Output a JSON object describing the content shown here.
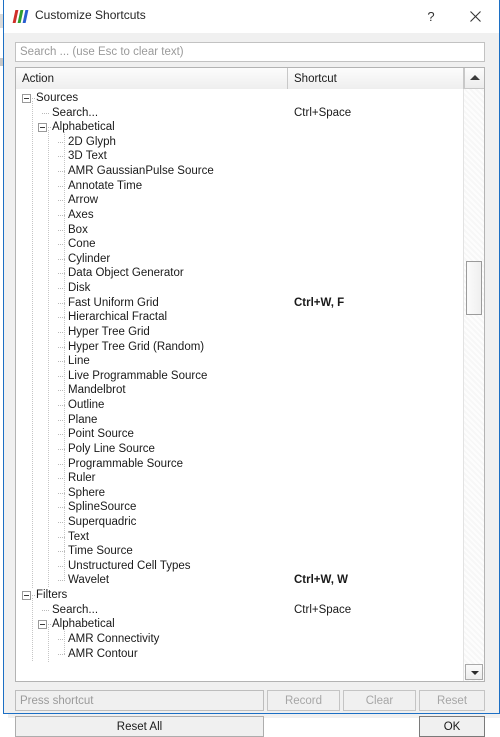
{
  "window": {
    "title": "Customize Shortcuts",
    "icon": "paraview-logo-icon",
    "help_label": "?",
    "close_label": "✕"
  },
  "search": {
    "placeholder": "Search ... (use Esc to clear text)",
    "value": ""
  },
  "table": {
    "columns": [
      "Action",
      "Shortcut"
    ],
    "sort_indicator": "up-arrow-icon"
  },
  "tree": [
    {
      "label": "Sources",
      "shortcut": "",
      "depth": 0,
      "expander": true,
      "group": true
    },
    {
      "label": "Search...",
      "shortcut": "Ctrl+Space",
      "depth": 1,
      "expander": false,
      "group": false
    },
    {
      "label": "Alphabetical",
      "shortcut": "",
      "depth": 1,
      "expander": true,
      "group": false
    },
    {
      "label": "2D Glyph",
      "shortcut": "",
      "depth": 2,
      "expander": false,
      "group": false
    },
    {
      "label": "3D Text",
      "shortcut": "",
      "depth": 2,
      "expander": false,
      "group": false
    },
    {
      "label": "AMR GaussianPulse Source",
      "shortcut": "",
      "depth": 2,
      "expander": false,
      "group": false
    },
    {
      "label": "Annotate Time",
      "shortcut": "",
      "depth": 2,
      "expander": false,
      "group": false
    },
    {
      "label": "Arrow",
      "shortcut": "",
      "depth": 2,
      "expander": false,
      "group": false
    },
    {
      "label": "Axes",
      "shortcut": "",
      "depth": 2,
      "expander": false,
      "group": false
    },
    {
      "label": "Box",
      "shortcut": "",
      "depth": 2,
      "expander": false,
      "group": false
    },
    {
      "label": "Cone",
      "shortcut": "",
      "depth": 2,
      "expander": false,
      "group": false
    },
    {
      "label": "Cylinder",
      "shortcut": "",
      "depth": 2,
      "expander": false,
      "group": false
    },
    {
      "label": "Data Object Generator",
      "shortcut": "",
      "depth": 2,
      "expander": false,
      "group": false
    },
    {
      "label": "Disk",
      "shortcut": "",
      "depth": 2,
      "expander": false,
      "group": false
    },
    {
      "label": "Fast Uniform Grid",
      "shortcut": "Ctrl+W, F",
      "depth": 2,
      "expander": false,
      "group": false,
      "bold": true
    },
    {
      "label": "Hierarchical Fractal",
      "shortcut": "",
      "depth": 2,
      "expander": false,
      "group": false
    },
    {
      "label": "Hyper Tree Grid",
      "shortcut": "",
      "depth": 2,
      "expander": false,
      "group": false
    },
    {
      "label": "Hyper Tree Grid (Random)",
      "shortcut": "",
      "depth": 2,
      "expander": false,
      "group": false
    },
    {
      "label": "Line",
      "shortcut": "",
      "depth": 2,
      "expander": false,
      "group": false
    },
    {
      "label": "Live Programmable Source",
      "shortcut": "",
      "depth": 2,
      "expander": false,
      "group": false
    },
    {
      "label": "Mandelbrot",
      "shortcut": "",
      "depth": 2,
      "expander": false,
      "group": false
    },
    {
      "label": "Outline",
      "shortcut": "",
      "depth": 2,
      "expander": false,
      "group": false
    },
    {
      "label": "Plane",
      "shortcut": "",
      "depth": 2,
      "expander": false,
      "group": false
    },
    {
      "label": "Point Source",
      "shortcut": "",
      "depth": 2,
      "expander": false,
      "group": false
    },
    {
      "label": "Poly Line Source",
      "shortcut": "",
      "depth": 2,
      "expander": false,
      "group": false
    },
    {
      "label": "Programmable Source",
      "shortcut": "",
      "depth": 2,
      "expander": false,
      "group": false
    },
    {
      "label": "Ruler",
      "shortcut": "",
      "depth": 2,
      "expander": false,
      "group": false
    },
    {
      "label": "Sphere",
      "shortcut": "",
      "depth": 2,
      "expander": false,
      "group": false
    },
    {
      "label": "SplineSource",
      "shortcut": "",
      "depth": 2,
      "expander": false,
      "group": false
    },
    {
      "label": "Superquadric",
      "shortcut": "",
      "depth": 2,
      "expander": false,
      "group": false
    },
    {
      "label": "Text",
      "shortcut": "",
      "depth": 2,
      "expander": false,
      "group": false
    },
    {
      "label": "Time Source",
      "shortcut": "",
      "depth": 2,
      "expander": false,
      "group": false
    },
    {
      "label": "Unstructured Cell Types",
      "shortcut": "",
      "depth": 2,
      "expander": false,
      "group": false
    },
    {
      "label": "Wavelet",
      "shortcut": "Ctrl+W, W",
      "depth": 2,
      "expander": false,
      "group": false,
      "bold": true
    },
    {
      "label": "Filters",
      "shortcut": "",
      "depth": 0,
      "expander": true,
      "group": true
    },
    {
      "label": "Search...",
      "shortcut": "Ctrl+Space",
      "depth": 1,
      "expander": false,
      "group": false
    },
    {
      "label": "Alphabetical",
      "shortcut": "",
      "depth": 1,
      "expander": true,
      "group": false
    },
    {
      "label": "AMR Connectivity",
      "shortcut": "",
      "depth": 2,
      "expander": false,
      "group": false
    },
    {
      "label": "AMR Contour",
      "shortcut": "",
      "depth": 2,
      "expander": false,
      "group": false
    }
  ],
  "footer": {
    "press_shortcut_placeholder": "Press shortcut",
    "record_label": "Record",
    "clear_label": "Clear",
    "reset_label": "Reset",
    "reset_all_label": "Reset All",
    "ok_label": "OK"
  },
  "colors": {
    "window_border": "#1c6fc4",
    "panel_bg": "#f0f0f0",
    "tree_bg": "#ffffff",
    "text": "#1a1a1a",
    "placeholder": "#9a9a9a",
    "disabled_text": "#a6a6a6"
  }
}
